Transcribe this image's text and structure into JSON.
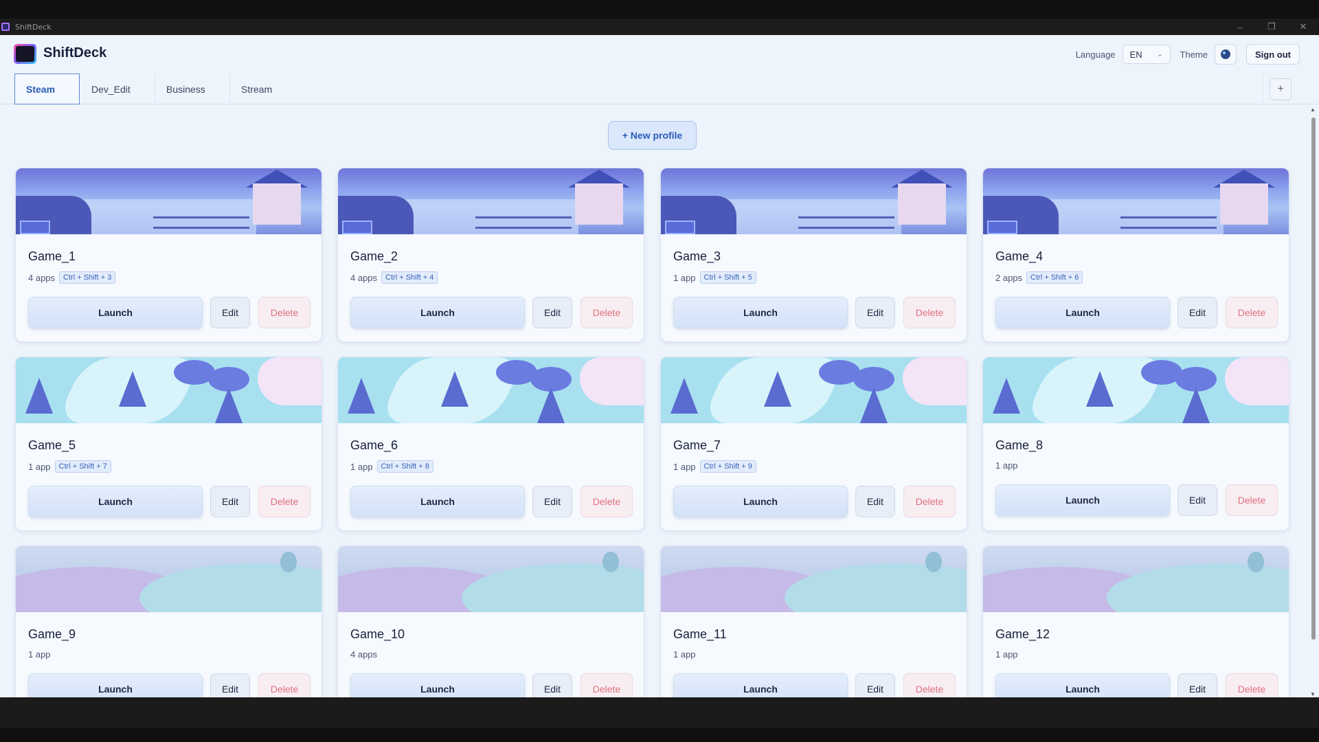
{
  "window": {
    "title": "ShiftDeck",
    "minimize": "–",
    "maximize": "❐",
    "close": "✕"
  },
  "header": {
    "brand": "ShiftDeck",
    "language_label": "Language",
    "language_value": "EN",
    "theme_label": "Theme",
    "sign_out": "Sign out"
  },
  "tabs": [
    {
      "label": "Steam",
      "active": true
    },
    {
      "label": "Dev_Edit",
      "active": false
    },
    {
      "label": "Business",
      "active": false
    },
    {
      "label": "Stream",
      "active": false
    }
  ],
  "tab_add": "+",
  "new_profile": "+ New profile",
  "buttons": {
    "launch": "Launch",
    "edit": "Edit",
    "delete": "Delete"
  },
  "cards": [
    {
      "name": "Game_1",
      "apps": "4 apps",
      "hotkey": "Ctrl + Shift + 3",
      "banner": "lake-village"
    },
    {
      "name": "Game_2",
      "apps": "4 apps",
      "hotkey": "Ctrl + Shift + 4",
      "banner": "lake-village"
    },
    {
      "name": "Game_3",
      "apps": "1 app",
      "hotkey": "Ctrl + Shift + 5",
      "banner": "lake-village"
    },
    {
      "name": "Game_4",
      "apps": "2 apps",
      "hotkey": "Ctrl + Shift + 6",
      "banner": "lake-village"
    },
    {
      "name": "Game_5",
      "apps": "1 app",
      "hotkey": "Ctrl + Shift + 7",
      "banner": "forest-river"
    },
    {
      "name": "Game_6",
      "apps": "1 app",
      "hotkey": "Ctrl + Shift + 8",
      "banner": "forest-river"
    },
    {
      "name": "Game_7",
      "apps": "1 app",
      "hotkey": "Ctrl + Shift + 9",
      "banner": "forest-river"
    },
    {
      "name": "Game_8",
      "apps": "1 app",
      "hotkey": "",
      "banner": "forest-river"
    },
    {
      "name": "Game_9",
      "apps": "1 app",
      "hotkey": "",
      "banner": "hills"
    },
    {
      "name": "Game_10",
      "apps": "4 apps",
      "hotkey": "",
      "banner": "hills"
    },
    {
      "name": "Game_11",
      "apps": "1 app",
      "hotkey": "",
      "banner": "hills"
    },
    {
      "name": "Game_12",
      "apps": "1 app",
      "hotkey": "",
      "banner": "hills"
    }
  ],
  "colors": {
    "accent": "#2a5ab8",
    "delete": "#e0707e",
    "background": "#eef4fc"
  }
}
